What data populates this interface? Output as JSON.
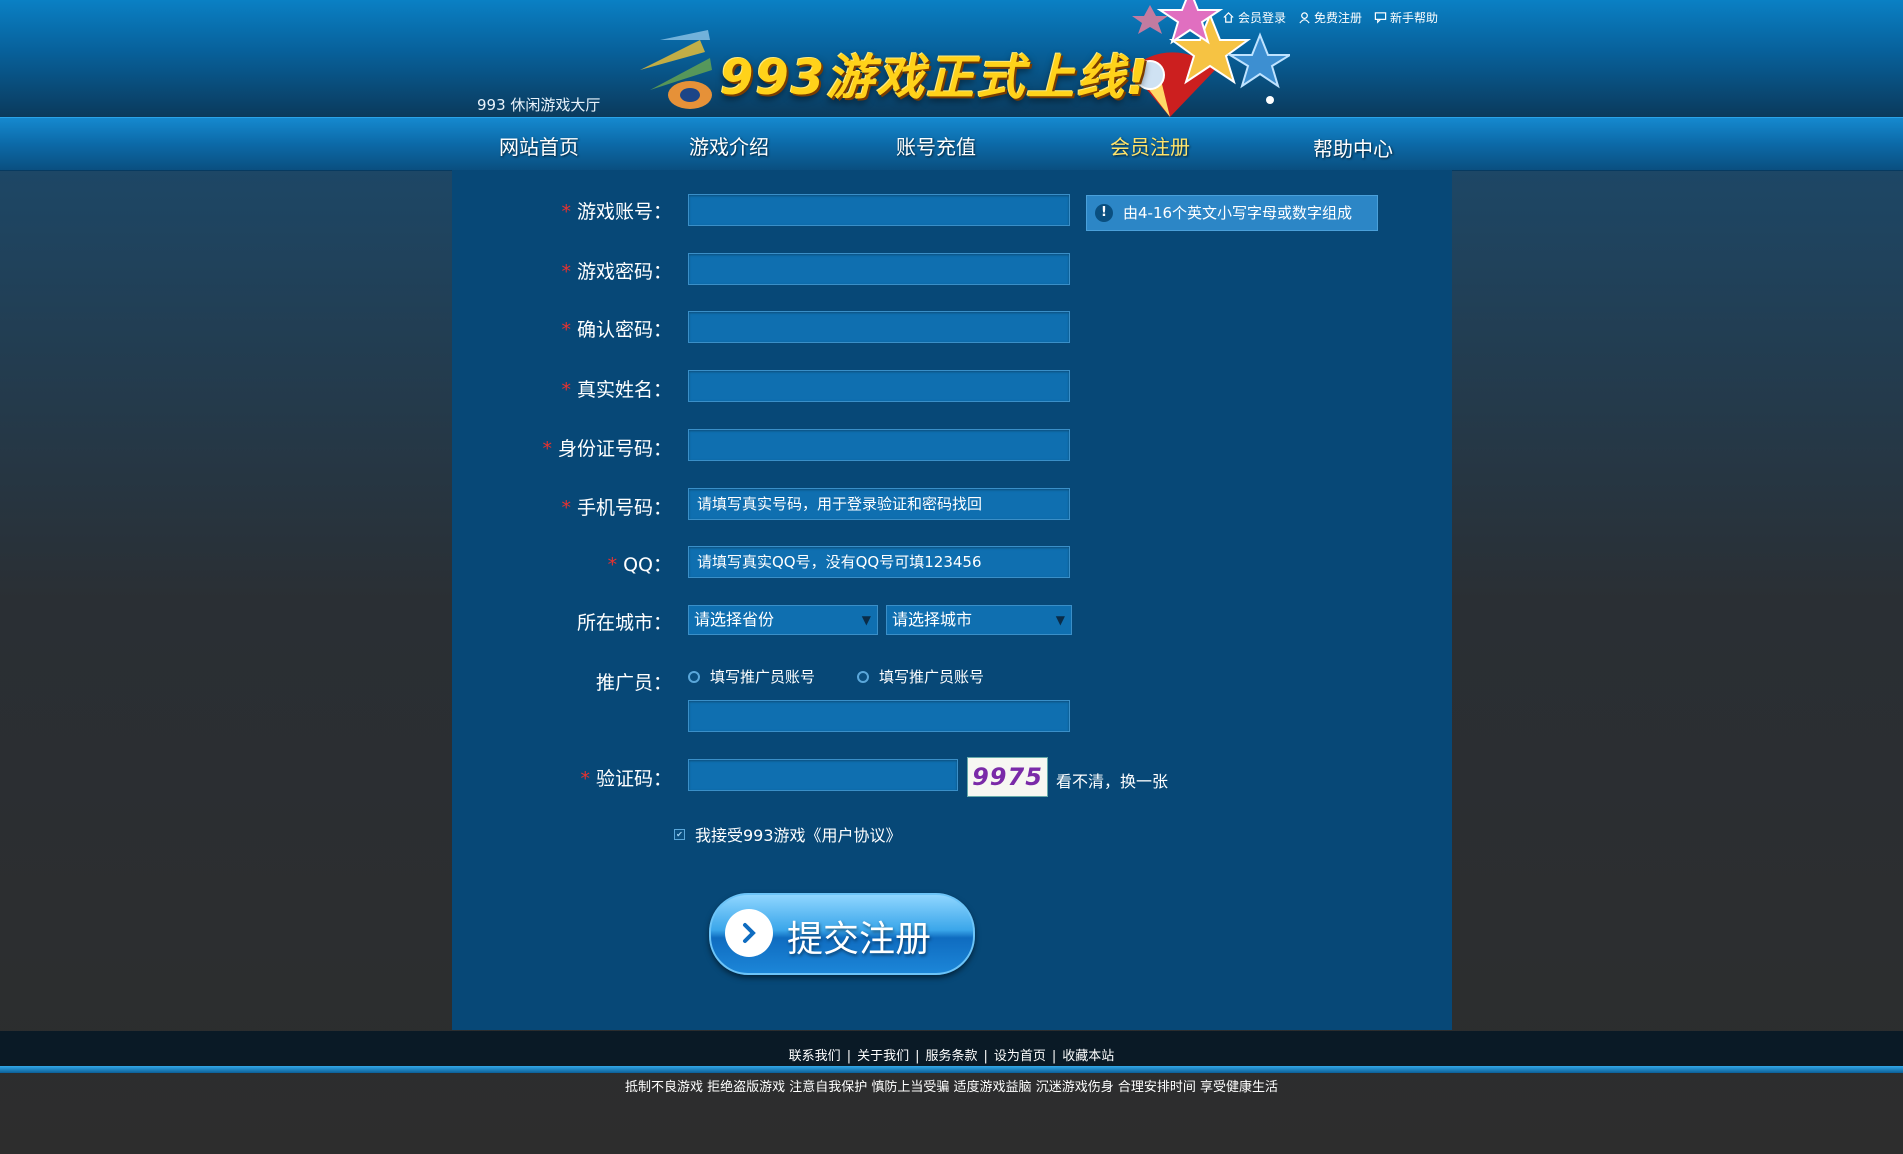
{
  "header": {
    "site_title": "993 休闲游戏大厅",
    "banner_text": "993游戏正式上线!",
    "top_links": [
      {
        "label": "会员登录",
        "icon": "home-icon"
      },
      {
        "label": "免费注册",
        "icon": "user-icon"
      },
      {
        "label": "新手帮助",
        "icon": "chat-icon"
      }
    ]
  },
  "nav": {
    "items": [
      {
        "label": "网站首页"
      },
      {
        "label": "游戏介绍"
      },
      {
        "label": "账号充值"
      },
      {
        "label": "会员注册",
        "active": true
      },
      {
        "label": "帮助中心"
      }
    ]
  },
  "form": {
    "required_mark": "*",
    "account_label": "游戏账号：",
    "account_hint": "由4-16个英文小写字母或数字组成",
    "hint_icon": "!",
    "password_label": "游戏密码：",
    "confirm_label": "确认密码：",
    "realname_label": "真实姓名：",
    "idcard_label": "身份证号码：",
    "phone_label": "手机号码：",
    "phone_placeholder": "请填写真实号码，用于登录验证和密码找回",
    "qq_label": "QQ：",
    "qq_placeholder": "请填写真实QQ号，没有QQ号可填123456",
    "city_label": "所在城市：",
    "province_select": "请选择省份",
    "city_select": "请选择城市",
    "promoter_label": "推广员：",
    "promoter_options": [
      "填写推广员账号",
      "填写推广员账号"
    ],
    "captcha_label": "验证码：",
    "captcha_value": "9975",
    "captcha_refresh": "看不清，换一张",
    "agree_text": "我接受993游戏《用户协议》",
    "submit_label": "提交注册"
  },
  "footer": {
    "links": [
      "联系我们",
      "关于我们",
      "服务条款",
      "设为首页",
      "收藏本站"
    ],
    "separator": "|",
    "slogan": "抵制不良游戏 拒绝盗版游戏 注意自我保护 慎防上当受骗 适度游戏益脑 沉迷游戏伤身 合理安排时间 享受健康生活"
  },
  "colors": {
    "header_blue": "#0a80c4",
    "panel_blue": "#074877",
    "input_blue": "#0f6fb0",
    "active_nav": "#ffe46b",
    "required_red": "#e8322f"
  }
}
